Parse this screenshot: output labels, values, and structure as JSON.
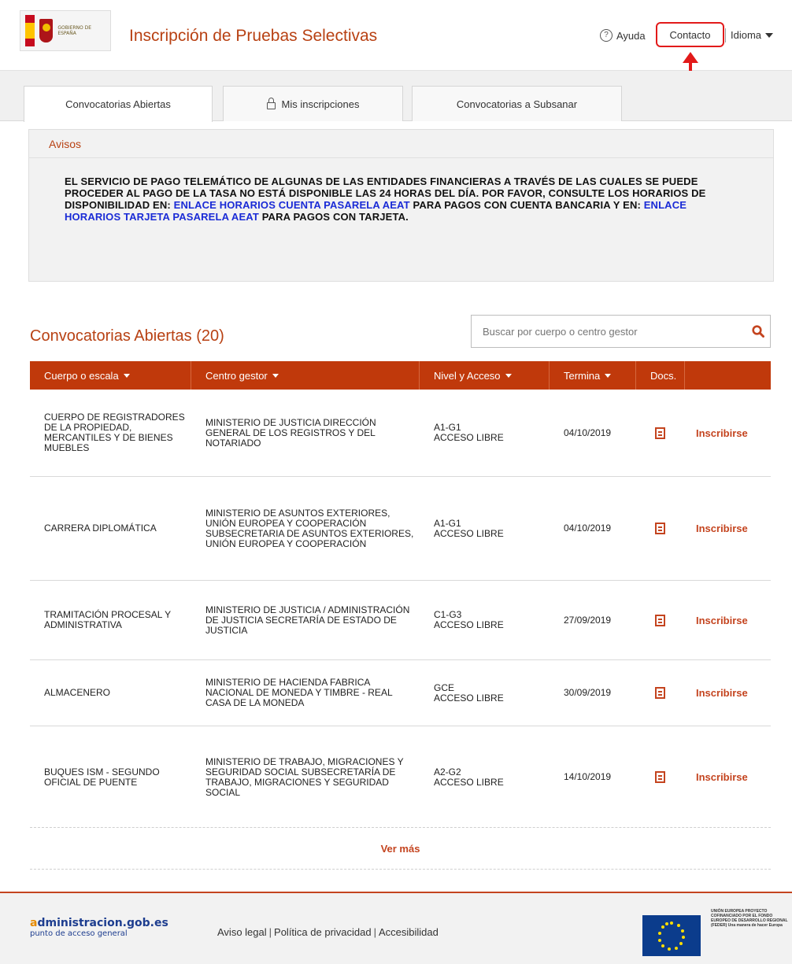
{
  "header": {
    "logo_text": "GOBIERNO DE ESPAÑA",
    "title": "Inscripción de Pruebas Selectivas",
    "help_label": "Ayuda",
    "help_icon": "?",
    "contact_label": "Contacto",
    "language_label": "Idioma"
  },
  "tabs": [
    {
      "label": "Convocatorias Abiertas",
      "active": true
    },
    {
      "label": "Mis inscripciones",
      "icon": "lock-icon"
    },
    {
      "label": "Convocatorias a Subsanar"
    }
  ],
  "notices": {
    "title": "Avisos",
    "text_1": "EL SERVICIO DE PAGO TELEMÁTICO DE ALGUNAS DE LAS ENTIDADES FINANCIERAS A TRAVÉS DE LAS CUALES SE PUEDE PROCEDER AL PAGO DE LA TASA NO ESTÁ DISPONIBLE LAS 24 HORAS DEL DÍA. POR FAVOR, CONSULTE LOS HORARIOS DE DISPONIBILIDAD EN: ",
    "link_1": "ENLACE HORARIOS CUENTA PASARELA AEAT",
    "text_2": " PARA PAGOS CON CUENTA BANCARIA Y EN: ",
    "link_2": "ENLACE HORARIOS TARJETA PASARELA AEAT",
    "text_3": " PARA PAGOS CON TARJETA."
  },
  "listing": {
    "title": "Convocatorias Abiertas (20)",
    "search_placeholder": "Buscar por cuerpo o centro gestor",
    "columns": [
      "Cuerpo o escala",
      "Centro gestor",
      "Nivel y Acceso",
      "Termina",
      "Docs.",
      ""
    ],
    "rows": [
      {
        "cuerpo": "CUERPO DE REGISTRADORES DE LA PROPIEDAD, MERCANTILES Y DE BIENES MUEBLES",
        "centro": "MINISTERIO DE JUSTICIA DIRECCIÓN GENERAL DE LOS REGISTROS Y DEL NOTARIADO",
        "nivel": "A1-G1",
        "acceso": "ACCESO LIBRE",
        "termina": "04/10/2019",
        "action": "Inscribirse"
      },
      {
        "cuerpo": "CARRERA DIPLOMÁTICA",
        "centro": "MINISTERIO DE ASUNTOS EXTERIORES, UNIÓN EUROPEA Y COOPERACIÓN SUBSECRETARIA DE ASUNTOS EXTERIORES, UNIÓN EUROPEA Y COOPERACIÓN",
        "nivel": "A1-G1",
        "acceso": "ACCESO LIBRE",
        "termina": "04/10/2019",
        "action": "Inscribirse"
      },
      {
        "cuerpo": "TRAMITACIÓN PROCESAL Y ADMINISTRATIVA",
        "centro": "MINISTERIO DE JUSTICIA / ADMINISTRACIÓN DE JUSTICIA SECRETARÍA DE ESTADO DE JUSTICIA",
        "nivel": "C1-G3",
        "acceso": "ACCESO LIBRE",
        "termina": "27/09/2019",
        "action": "Inscribirse"
      },
      {
        "cuerpo": "ALMACENERO",
        "centro": "MINISTERIO DE HACIENDA FABRICA NACIONAL DE MONEDA Y TIMBRE - REAL CASA DE LA MONEDA",
        "nivel": "GCE",
        "acceso": "ACCESO LIBRE",
        "termina": "30/09/2019",
        "action": "Inscribirse"
      },
      {
        "cuerpo": "BUQUES ISM - SEGUNDO OFICIAL DE PUENTE",
        "centro": "MINISTERIO DE TRABAJO, MIGRACIONES Y SEGURIDAD SOCIAL SUBSECRETARÍA DE TRABAJO, MIGRACIONES Y SEGURIDAD SOCIAL",
        "nivel": "A2-G2",
        "acceso": "ACCESO LIBRE",
        "termina": "14/10/2019",
        "action": "Inscribirse"
      }
    ],
    "more_label": "Ver más"
  },
  "footer": {
    "logo_main_a": "a",
    "logo_main_rest": "dministracion.gob.es",
    "logo_sub": "punto de acceso general",
    "links": [
      "Aviso legal",
      "Política de privacidad",
      "Accesibilidad"
    ],
    "eu_text": "UNIÓN EUROPEA PROYECTO COFINANCIADO POR EL FONDO EUROPEO DE DESARROLLO REGIONAL (FEDER) Una manera de hacer Europa"
  },
  "colors": {
    "accent": "#c0390b",
    "title": "#b84113",
    "link_blue": "#1a2bd6",
    "highlight_red": "#e21a1a"
  }
}
